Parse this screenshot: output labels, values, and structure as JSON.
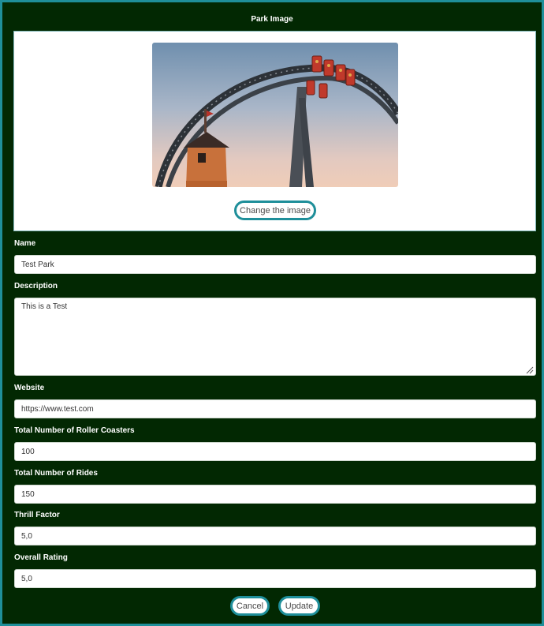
{
  "image_section": {
    "title": "Park Image",
    "photo_alt": "roller coaster loop photo",
    "change_button": "Change the image"
  },
  "form": {
    "name": {
      "label": "Name",
      "value": "Test Park"
    },
    "description": {
      "label": "Description",
      "value": "This is a Test"
    },
    "website": {
      "label": "Website",
      "value": "https://www.test.com"
    },
    "roller_coasters": {
      "label": "Total Number of Roller Coasters",
      "value": "100"
    },
    "rides": {
      "label": "Total Number of Rides",
      "value": "150"
    },
    "thrill_factor": {
      "label": "Thrill Factor",
      "value": "5,0"
    },
    "overall_rating": {
      "label": "Overall Rating",
      "value": "5,0"
    }
  },
  "actions": {
    "cancel_label": "Cancel",
    "update_label": "Update"
  },
  "colors": {
    "background": "#022802",
    "accent": "#1f8f9a",
    "panel": "#ffffff"
  }
}
